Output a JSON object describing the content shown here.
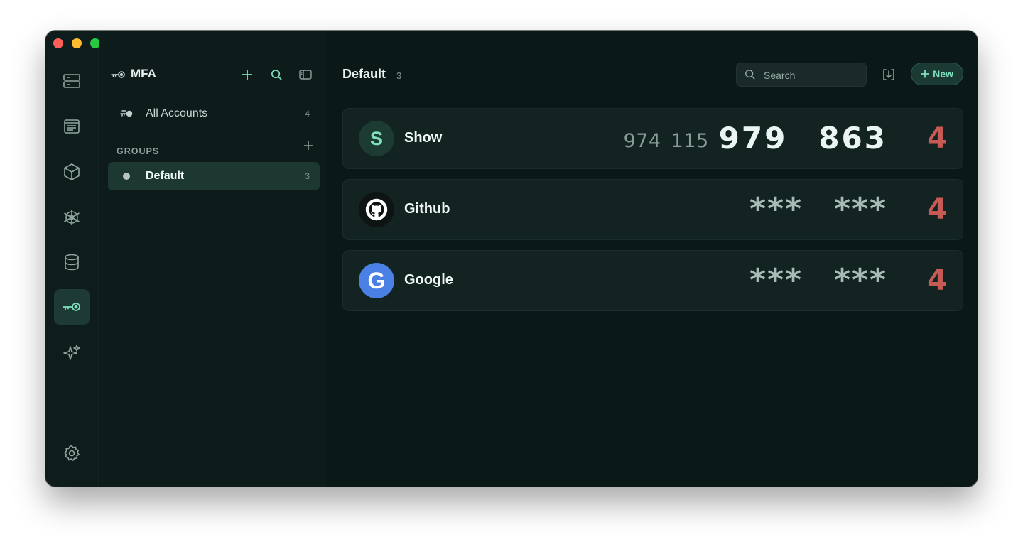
{
  "app": {
    "title": "MFA"
  },
  "sidebar": {
    "all_accounts": {
      "label": "All Accounts",
      "count": "4"
    },
    "groups_label": "GROUPS",
    "groups": [
      {
        "label": "Default",
        "count": "3"
      }
    ]
  },
  "main": {
    "title": "Default",
    "count": "3",
    "search": {
      "placeholder": "Search"
    },
    "new_label": "New"
  },
  "accounts": [
    {
      "name": "Show",
      "initial": "S",
      "prev_code": [
        "974",
        "115"
      ],
      "code": [
        "979",
        "863"
      ],
      "timer": "4"
    },
    {
      "name": "Github",
      "code": [
        "***",
        "***"
      ],
      "timer": "4"
    },
    {
      "name": "Google",
      "initial": "G",
      "code": [
        "***",
        "***"
      ],
      "timer": "4"
    }
  ],
  "colors": {
    "accent": "#7ee0bd",
    "timer": "#c65a55",
    "google_blue": "#4a7fe4",
    "active_bg": "#1c3831"
  },
  "icons": {
    "rail": [
      "server-icon",
      "document-icon",
      "package-icon",
      "helm-icon",
      "database-icon",
      "key-icon",
      "sparkle-icon",
      "gear-icon"
    ]
  }
}
